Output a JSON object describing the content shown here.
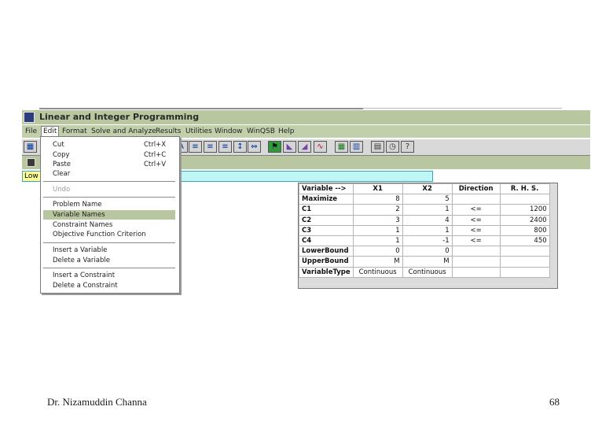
{
  "window": {
    "title": "Linear and Integer Programming"
  },
  "menubar": [
    "File",
    "Edit",
    "Format",
    "Solve and Analyze",
    "Results",
    "Utilities",
    "Window",
    "WinQSB",
    "Help"
  ],
  "cellbar": {
    "ref": "Low"
  },
  "edit_menu": {
    "items": [
      {
        "label": "Cut",
        "shortcut": "Ctrl+X"
      },
      {
        "label": "Copy",
        "shortcut": "Ctrl+C"
      },
      {
        "label": "Paste",
        "shortcut": "Ctrl+V"
      },
      {
        "label": "Clear",
        "shortcut": ""
      },
      {
        "label": "Undo",
        "shortcut": "",
        "disabled": true
      },
      {
        "label": "Problem Name",
        "shortcut": ""
      },
      {
        "label": "Variable Names",
        "shortcut": "",
        "highlighted": true
      },
      {
        "label": "Constraint Names",
        "shortcut": ""
      },
      {
        "label": "Objective Function Criterion",
        "shortcut": ""
      },
      {
        "label": "Insert a Variable",
        "shortcut": ""
      },
      {
        "label": "Delete a Variable",
        "shortcut": ""
      },
      {
        "label": "Insert a Constraint",
        "shortcut": ""
      },
      {
        "label": "Delete a Constraint",
        "shortcut": ""
      }
    ]
  },
  "grid": {
    "headers": [
      "Variable -->",
      "X1",
      "X2",
      "Direction",
      "R. H. S."
    ],
    "rows": [
      [
        "Maximize",
        "8",
        "5",
        "",
        ""
      ],
      [
        "C1",
        "2",
        "1",
        "<=",
        "1200"
      ],
      [
        "C2",
        "3",
        "4",
        "<=",
        "2400"
      ],
      [
        "C3",
        "1",
        "1",
        "<=",
        "800"
      ],
      [
        "C4",
        "1",
        "-1",
        "<=",
        "450"
      ],
      [
        "LowerBound",
        "0",
        "0",
        "",
        ""
      ],
      [
        "UpperBound",
        "M",
        "M",
        "",
        ""
      ],
      [
        "VariableType",
        "Continuous",
        "Continuous",
        "",
        ""
      ]
    ]
  },
  "footer": {
    "author": "Dr. Nizamuddin Channa",
    "page": "68"
  }
}
